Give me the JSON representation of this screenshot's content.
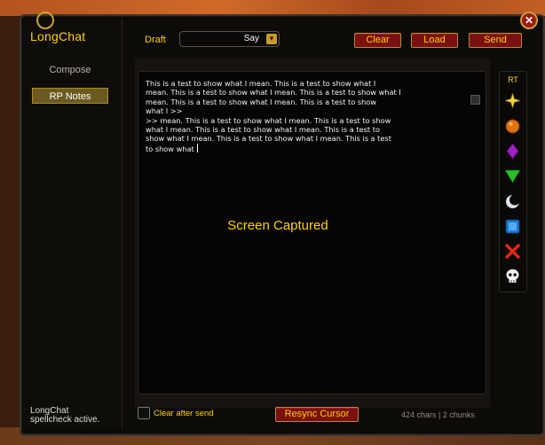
{
  "sidebar": {
    "title": "LongChat",
    "items": [
      {
        "label": "Compose",
        "active": false
      },
      {
        "label": "RP Notes",
        "active": true
      }
    ],
    "status_lines": [
      "LongChat",
      "spellcheck active."
    ]
  },
  "toolbar": {
    "draft_label": "Draft",
    "draft_value": "Say",
    "clear_label": "Clear",
    "load_label": "Load",
    "send_label": "Send"
  },
  "editor": {
    "text": "This is a test to show what I mean. This is a test to show what I\nmean. This is a test to show what I mean. This is a test to show what I\nmean. This is a test to show what I mean. This is a test to show\nwhat I >>\n>> mean. This is a test to show what I mean. This is a test to show\nwhat I mean. This is a test to show what I mean. This is a test to\nshow what I mean. This is a test to show what I mean. This is a test\nto show what "
  },
  "overlay": {
    "text": "Screen Captured"
  },
  "raid_targets": {
    "label": "RT",
    "icons": [
      "star-icon",
      "circle-icon",
      "diamond-icon",
      "triangle-icon",
      "moon-icon",
      "square-icon",
      "cross-icon",
      "skull-icon"
    ]
  },
  "footer": {
    "clear_after_send_label": "Clear after send",
    "resync_label": "Resync Cursor",
    "counts": "424 chars | 2 chunks"
  },
  "colors": {
    "accent_gold": "#ffd100",
    "button_red": "#7a1010",
    "background": "#0d0b08"
  }
}
